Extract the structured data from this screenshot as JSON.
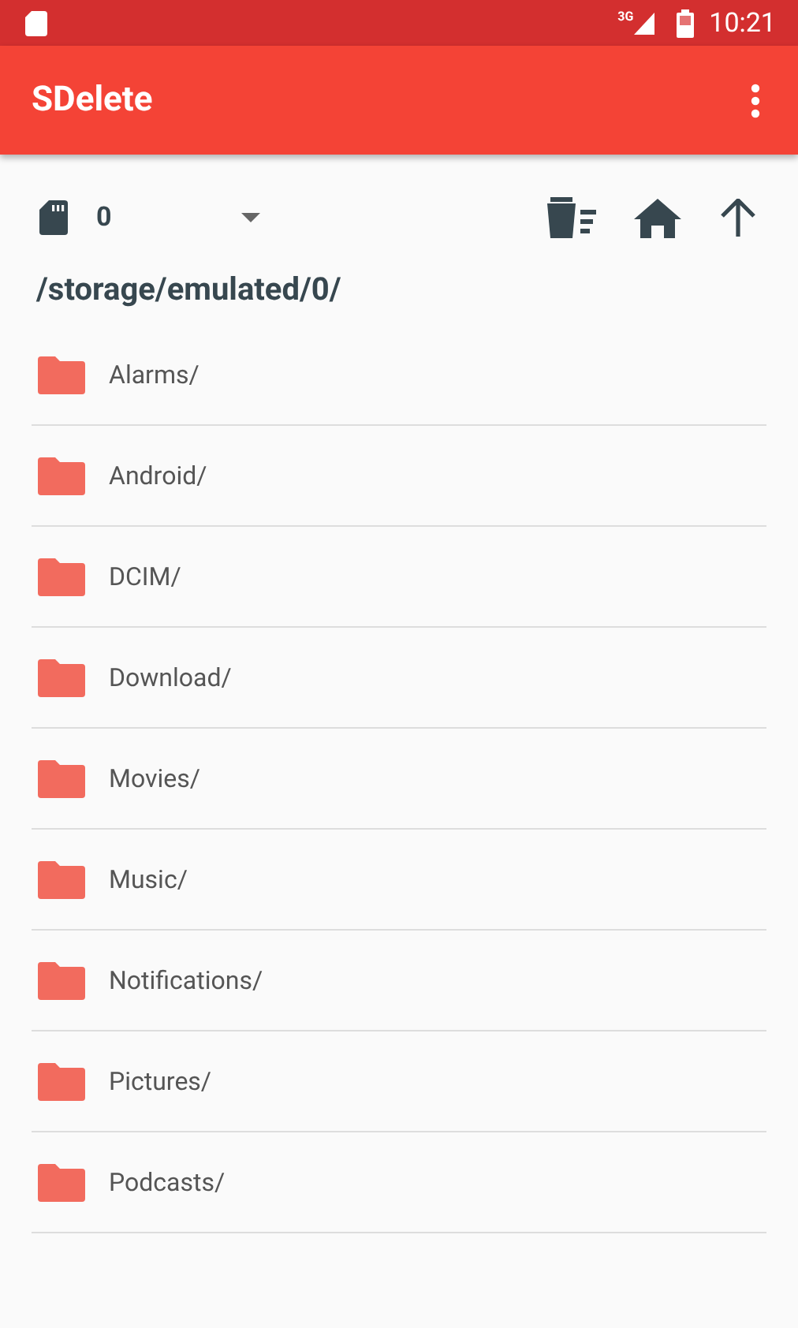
{
  "status_bar": {
    "network": "3G",
    "time": "10:21"
  },
  "app_bar": {
    "title": "SDelete"
  },
  "toolbar": {
    "storage": "0"
  },
  "path": "/storage/emulated/0/",
  "folders": [
    {
      "name": "Alarms/"
    },
    {
      "name": "Android/"
    },
    {
      "name": "DCIM/"
    },
    {
      "name": "Download/"
    },
    {
      "name": "Movies/"
    },
    {
      "name": "Music/"
    },
    {
      "name": "Notifications/"
    },
    {
      "name": "Pictures/"
    },
    {
      "name": "Podcasts/"
    }
  ]
}
